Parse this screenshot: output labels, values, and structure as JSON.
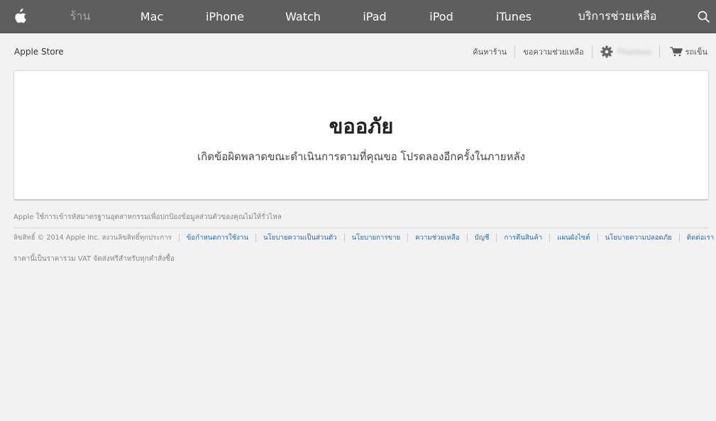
{
  "globalnav": {
    "items": [
      {
        "label": "ร้าน",
        "active": true
      },
      {
        "label": "Mac"
      },
      {
        "label": "iPhone"
      },
      {
        "label": "Watch"
      },
      {
        "label": "iPad"
      },
      {
        "label": "iPod"
      },
      {
        "label": "iTunes"
      },
      {
        "label": "บริการช่วยเหลือ"
      }
    ],
    "icons": {
      "logo": "apple-logo-icon",
      "search": "search-icon"
    }
  },
  "storehead": {
    "brand": "Apple Store",
    "search_label": "ค้นหาร้าน",
    "help_label": "ขอความช่วยเหลือ",
    "account_name": "Thonbeo",
    "cart_label": "รถเข็น",
    "icons": {
      "account": "gear-icon",
      "cart": "cart-icon"
    }
  },
  "message": {
    "title": "ขออภัย",
    "body": "เกิดข้อผิดพลาดขณะดำเนินการตามที่คุณขอ โปรดลองอีกครั้งในภายหลัง"
  },
  "footer": {
    "note": "Apple ใช้การเข้ารหัสมาตรฐานอุตสาหกรรมเพื่อปกป้องข้อมูลส่วนตัวของคุณไม่ให้รั่วไหล",
    "copyright": "ลิขสิทธิ์ © 2014 Apple Inc. สงวนลิขสิทธิ์ทุกประการ",
    "links": [
      "ข้อกำหนดการใช้งาน",
      "นโยบายความเป็นส่วนตัว",
      "นโยบายการขาย",
      "ความช่วยเหลือ",
      "บัญชี",
      "การคืนสินค้า",
      "แผนผังไซต์",
      "นโยบายความปลอดภัย",
      "ติดต่อเรา"
    ],
    "price_note": "ราคานี้เป็นราคารวม VAT จัดส่งฟรีสำหรับทุกคำสั่งซื้อ"
  },
  "colors": {
    "nav_bg": "#5e5e5e",
    "link": "#1f6fb8",
    "page_bg": "#f2f2f2"
  }
}
